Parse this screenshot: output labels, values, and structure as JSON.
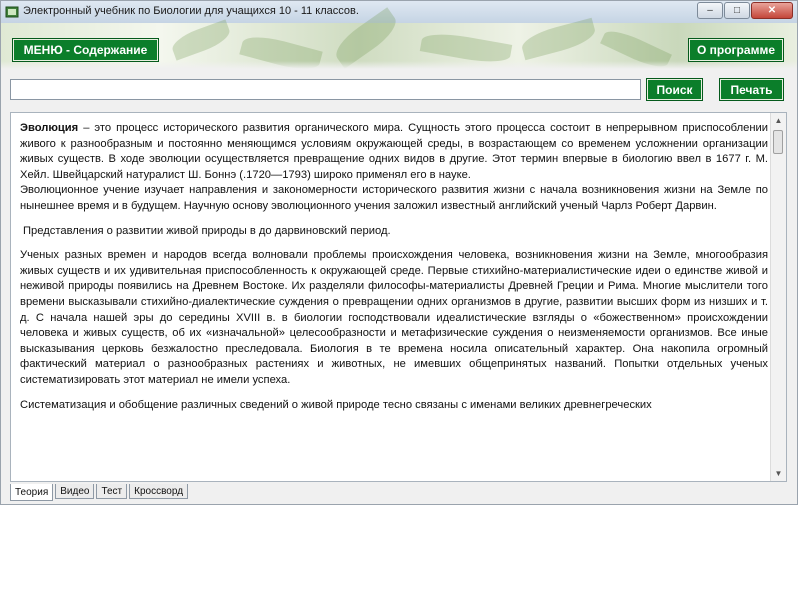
{
  "window": {
    "title": "Электронный учебник по Биологии для учащихся 10 - 11 классов.",
    "controls": {
      "minimize": "–",
      "maximize": "□",
      "close": "✕"
    }
  },
  "header": {
    "menu_button": "МЕНЮ - Содержание",
    "about_button": "О программе"
  },
  "search": {
    "value": "",
    "search_button": "Поиск",
    "print_button": "Печать"
  },
  "content": {
    "paragraph1_term": "Эволюция",
    "paragraph1_rest": " – это процесс исторического развития органического мира. Сущность этого процесса состоит в непрерывном приспособлении живого к разнообразным и постоянно меняющимся условиям окружающей среды, в возрастающем со временем усложнении организации живых существ. В ходе эволюции осуществляется превращение одних видов в другие. Этот термин впервые в биологию ввел в 1677 г. М. Хейл. Швейцарский натуралист Ш. Боннэ (.1720—1793) широко применял его в науке.",
    "paragraph2": "Эволюционное учение изучает направления и закономерности исторического развития жизни с начала возникновения жизни на Земле по нынешнее время и в будущем. Научную основу эволюционного учения заложил известный английский ученый Чарлз Роберт Дарвин.",
    "heading": "Представления о развитии живой природы в до дарвиновский период.",
    "paragraph3": "Ученых разных времен и народов всегда волновали проблемы происхождения человека, возникновения жизни на Земле, многообразия живых существ и их удивительная приспособленность к окружающей среде. Первые стихийно-материалистические идеи о единстве живой и неживой природы появились на Древнем Востоке. Их разделяли философы-материалисты Древней Греции и Рима. Многие мыслители того времени высказывали стихийно-диалектические суждения о превращении одних организмов в другие, развитии высших форм из низших и т. д. С начала нашей эры до середины XVIII в. в биологии господствовали идеалистические взгляды о «божественном» происхождении человека и живых существ, об их «изначальной» целесообразности и метафизические суждения о неизменяемости организмов. Все иные высказывания церковь безжалостно преследовала. Биология в те времена носила описательный характер. Она накопила огромный фактический материал о разнообразных растениях и животных, не имевших общепринятых названий. Попытки отдельных ученых систематизировать этот материал не имели успеха.",
    "paragraph4": "Систематизация и обобщение различных сведений о живой природе тесно связаны с именами великих древнегреческих"
  },
  "tabs": [
    {
      "label": "Теория",
      "active": true
    },
    {
      "label": "Видео",
      "active": false
    },
    {
      "label": "Тест",
      "active": false
    },
    {
      "label": "Кроссворд",
      "active": false
    }
  ],
  "colors": {
    "button_green": "#0b7e2a",
    "button_text": "#ffffff"
  }
}
